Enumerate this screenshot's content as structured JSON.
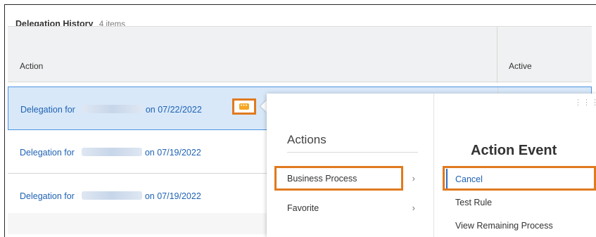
{
  "history": {
    "title": "Delegation History",
    "count": "4 items"
  },
  "table": {
    "columns": [
      "Action",
      "Active"
    ],
    "rows": [
      {
        "prefix": "Delegation for",
        "suffix": "on 07/22/2022",
        "selected": true
      },
      {
        "prefix": "Delegation for",
        "suffix": "on 07/19/2022",
        "selected": false
      },
      {
        "prefix": "Delegation for",
        "suffix": "on 07/19/2022",
        "selected": false
      }
    ]
  },
  "related_actions": {
    "icon": "related-actions-icon",
    "glyph": "•••",
    "accent": "#f6a623"
  },
  "actions_menu": {
    "title": "Actions",
    "items": [
      {
        "label": "Business Process",
        "chevron": "›"
      },
      {
        "label": "Favorite",
        "chevron": "›"
      }
    ]
  },
  "action_event": {
    "title": "Action Event",
    "items": [
      "Cancel",
      "Test Rule",
      "View Remaining Process"
    ],
    "grip": "⋮⋮⋮"
  },
  "colors": {
    "highlight_box": "#e07a1f",
    "link": "#1f62b3",
    "selected_row": "#d8e8f9",
    "selected_border": "#4d94e0"
  }
}
